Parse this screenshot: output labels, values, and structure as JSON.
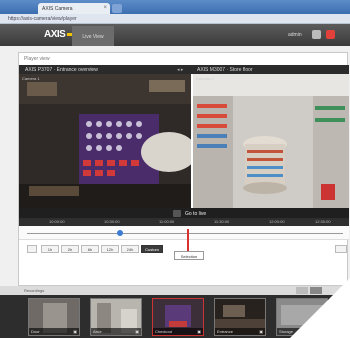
{
  "browser": {
    "tab_title": "AXIS Camera",
    "close_glyph": "×",
    "address": "https://axis-camera/view/player"
  },
  "header": {
    "logo": "AXIS",
    "tab_label": "Live View",
    "user": "admin",
    "icons": [
      "gear-icon",
      "help-icon"
    ]
  },
  "panel": {
    "breadcrumb": "Player view",
    "left_camera": "AXIS P3707 · Entrance overview",
    "right_camera": "AXIS M3007 · Store floor",
    "controls": "◂ ▸",
    "left_video_label": "Camera 1",
    "right_video_label": "Camera 2"
  },
  "timeline": {
    "live_label": "Go to live",
    "ticks": [
      "10:00:00",
      "10:30:00",
      "11:00:00",
      "11:30:00",
      "12:00:00",
      "12:30:00"
    ]
  },
  "tools": {
    "buttons": [
      "1h",
      "2h",
      "6h",
      "12h",
      "24h",
      "Custom"
    ],
    "active": "Custom",
    "tooltip": "Selection"
  },
  "thumbs": {
    "label": "Recordings",
    "items": [
      {
        "caption": "Door",
        "icon": "▣"
      },
      {
        "caption": "Aisle",
        "icon": "▣"
      },
      {
        "caption": "Checkout",
        "icon": "▣"
      },
      {
        "caption": "Entrance",
        "icon": "▣"
      },
      {
        "caption": "Storage",
        "icon": "▣"
      }
    ]
  },
  "colors": {
    "accent": "#f5c400",
    "timeline_marker": "#d93030",
    "scrub_handle": "#3a7bd5"
  }
}
